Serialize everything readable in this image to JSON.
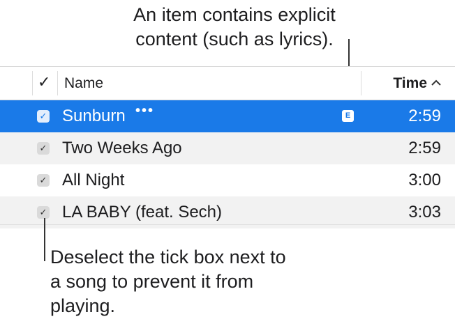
{
  "callouts": {
    "explicit": "An item contains explicit content (such as lyrics).",
    "checkbox": "Deselect the tick box next to a song to prevent it from playing."
  },
  "table": {
    "header": {
      "check_mark": "✓",
      "name_label": "Name",
      "time_label": "Time",
      "sort_icon": "chevron-up"
    },
    "rows": [
      {
        "title": "Sunburn",
        "more": "•••",
        "explicit_badge": "E",
        "time": "2:59",
        "checked": true,
        "selected": true
      },
      {
        "title": "Two Weeks Ago",
        "time": "2:59",
        "checked": true,
        "selected": false
      },
      {
        "title": "All Night",
        "time": "3:00",
        "checked": true,
        "selected": false
      },
      {
        "title": "LA BABY (feat. Sech)",
        "time": "3:03",
        "checked": true,
        "selected": false
      }
    ],
    "checkbox_glyph": "✓"
  },
  "colors": {
    "selection": "#1a7ae8",
    "stripe": "#f2f2f2"
  }
}
